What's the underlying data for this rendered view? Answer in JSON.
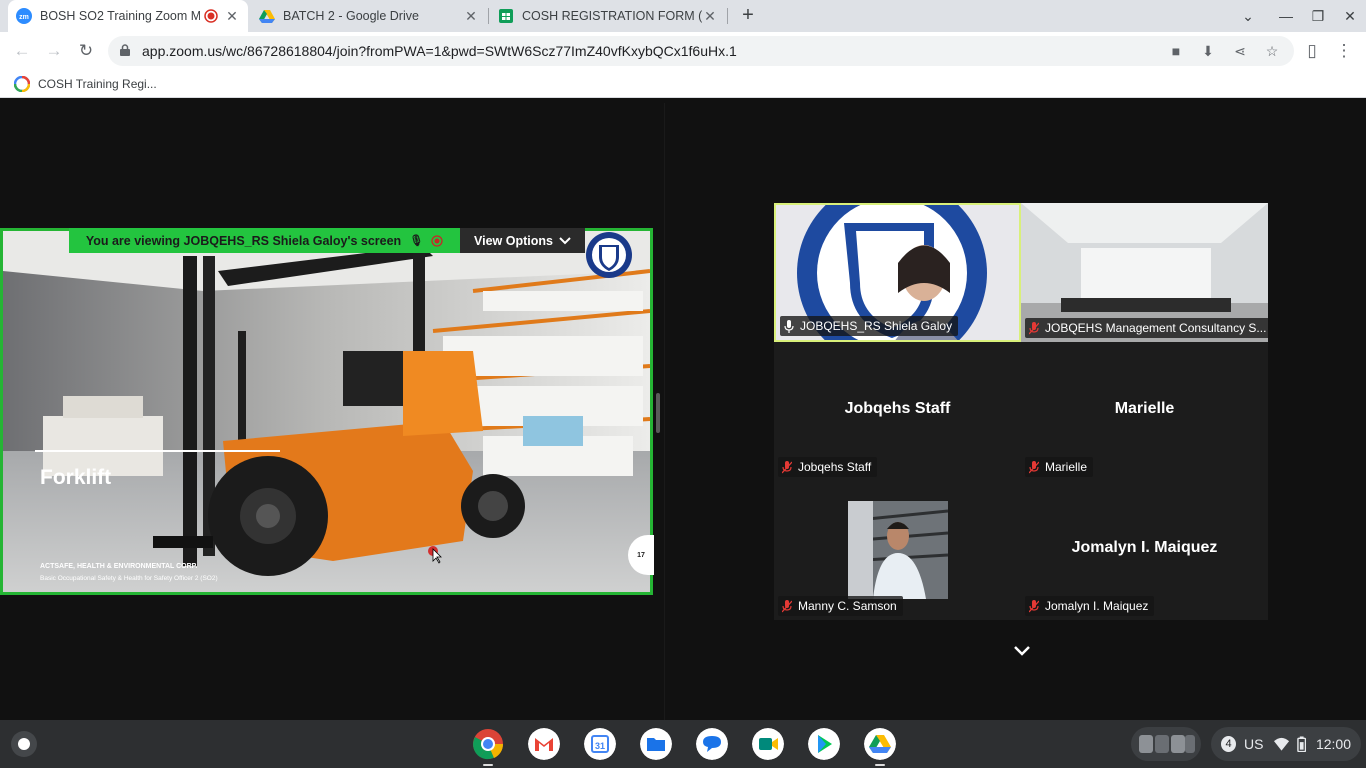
{
  "browser": {
    "tabs": [
      {
        "title": "BOSH SO2 Training Zoom M",
        "active": true,
        "recording": true
      },
      {
        "title": "BATCH 2 - Google Drive",
        "active": false
      },
      {
        "title": "COSH REGISTRATION FORM (Res",
        "active": false
      }
    ],
    "url": "app.zoom.us/wc/86728618804/join?fromPWA=1&pwd=SWtW6Scz77ImZ40vfKxybQCx1f6uHx.1",
    "bookmarks": [
      "COSH Training Regi..."
    ]
  },
  "zoom": {
    "viewing_banner": "You are viewing  JOBQEHS_RS Shiela Galoy's screen",
    "view_options_label": "View Options",
    "slide": {
      "title": "Forklift",
      "company": "ACTSAFE, HEALTH & ENVIRONMENTAL CORP.",
      "course": "Basic Occupational Safety & Health for Safety Officer 2 (SO2)",
      "page_number": "17"
    },
    "participants": [
      {
        "name": "JOBQEHS_RS Shiela Galoy",
        "video": true,
        "speaking": true
      },
      {
        "name": "JOBQEHS Management Consultancy S...",
        "video": true,
        "muted": true
      },
      {
        "name": "Jobqehs Staff",
        "display": "Jobqehs Staff",
        "muted": true
      },
      {
        "name": "Marielle",
        "display": "Marielle",
        "muted": true
      },
      {
        "name": "Manny C. Samson",
        "video": true,
        "muted": true
      },
      {
        "name": "Jomalyn I. Maiquez",
        "display": "Jomalyn I. Maiquez",
        "muted": true
      }
    ]
  },
  "shelf": {
    "notification_count": "4",
    "keyboard_layout": "US",
    "time": "12:00"
  },
  "colors": {
    "share_border": "#25b534",
    "banner_green": "#23c43f",
    "active_speaker_border": "#d9f07a"
  }
}
